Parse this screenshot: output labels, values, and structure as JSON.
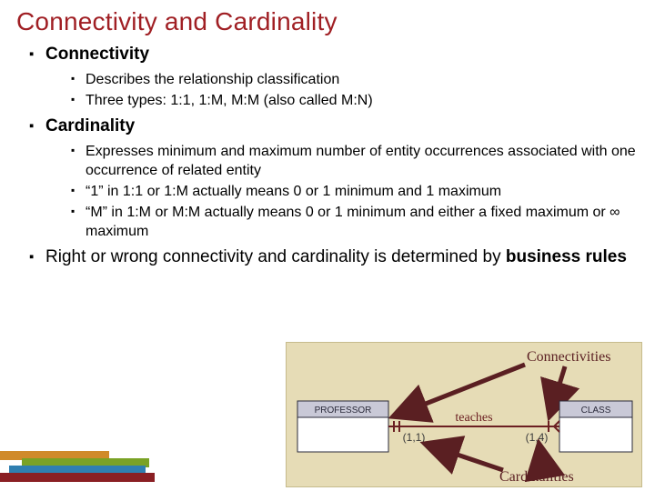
{
  "title": "Connectivity and Cardinality",
  "sections": [
    {
      "heading": "Connectivity",
      "items": [
        "Describes the relationship classification",
        "Three types: 1:1, 1:M, M:M (also called M:N)"
      ]
    },
    {
      "heading": "Cardinality",
      "items": [
        "Expresses minimum and maximum number of entity occurrences associated with one occurrence of related entity",
        "“1” in 1:1 or 1:M actually means 0 or 1 minimum and 1 maximum",
        "“M” in 1:M or M:M actually means 0 or 1 minimum and either a fixed maximum or ∞ maximum"
      ]
    },
    {
      "heading_prefix": "Right or wrong connectivity and cardinality is determined by ",
      "heading_bold": "business rules",
      "items": []
    }
  ],
  "diagram": {
    "label_connectivities": "Connectivities",
    "label_cardinalities": "Cardinalities",
    "label_teaches": "teaches",
    "entity_left": "PROFESSOR",
    "entity_right": "CLASS",
    "card_left": "(1,1)",
    "card_right": "(1,4)"
  }
}
